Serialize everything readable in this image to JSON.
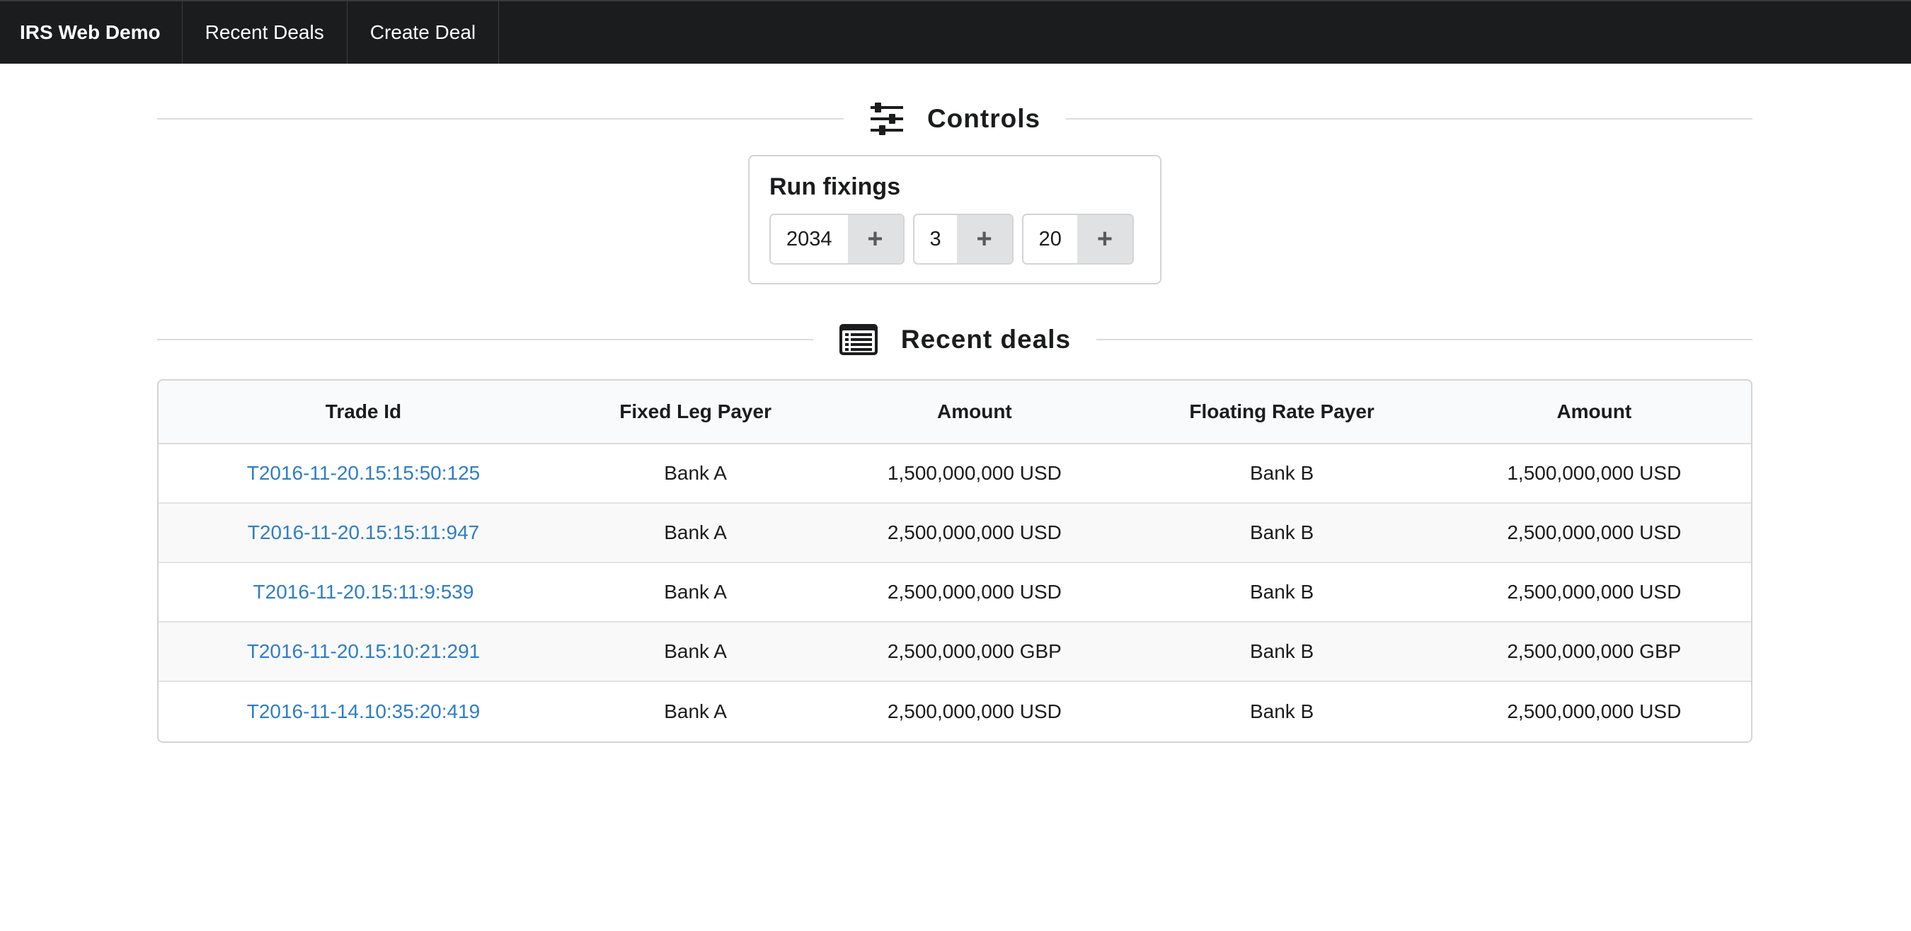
{
  "nav": {
    "brand": "IRS Web Demo",
    "items": [
      {
        "label": "Recent Deals"
      },
      {
        "label": "Create Deal"
      }
    ]
  },
  "controls": {
    "section_title": "Controls",
    "icon": "sliders-icon",
    "card_title": "Run fixings",
    "steppers": [
      {
        "value": "2034",
        "button": "+"
      },
      {
        "value": "3",
        "button": "+"
      },
      {
        "value": "20",
        "button": "+"
      }
    ]
  },
  "recent_deals": {
    "section_title": "Recent deals",
    "icon": "list-alternate-icon",
    "columns": [
      "Trade Id",
      "Fixed Leg Payer",
      "Amount",
      "Floating Rate Payer",
      "Amount"
    ],
    "rows": [
      {
        "trade_id": "T2016-11-20.15:15:50:125",
        "fixed_payer": "Bank A",
        "fixed_amount": "1,500,000,000 USD",
        "floating_payer": "Bank B",
        "floating_amount": "1,500,000,000 USD"
      },
      {
        "trade_id": "T2016-11-20.15:15:11:947",
        "fixed_payer": "Bank A",
        "fixed_amount": "2,500,000,000 USD",
        "floating_payer": "Bank B",
        "floating_amount": "2,500,000,000 USD"
      },
      {
        "trade_id": "T2016-11-20.15:11:9:539",
        "fixed_payer": "Bank A",
        "fixed_amount": "2,500,000,000 USD",
        "floating_payer": "Bank B",
        "floating_amount": "2,500,000,000 USD"
      },
      {
        "trade_id": "T2016-11-20.15:10:21:291",
        "fixed_payer": "Bank A",
        "fixed_amount": "2,500,000,000 GBP",
        "floating_payer": "Bank B",
        "floating_amount": "2,500,000,000 GBP"
      },
      {
        "trade_id": "T2016-11-14.10:35:20:419",
        "fixed_payer": "Bank A",
        "fixed_amount": "2,500,000,000 USD",
        "floating_payer": "Bank B",
        "floating_amount": "2,500,000,000 USD"
      }
    ]
  },
  "colors": {
    "navbar": "#1b1c1d",
    "link": "#2f7dc8",
    "button_bg": "#e0e1e2"
  }
}
